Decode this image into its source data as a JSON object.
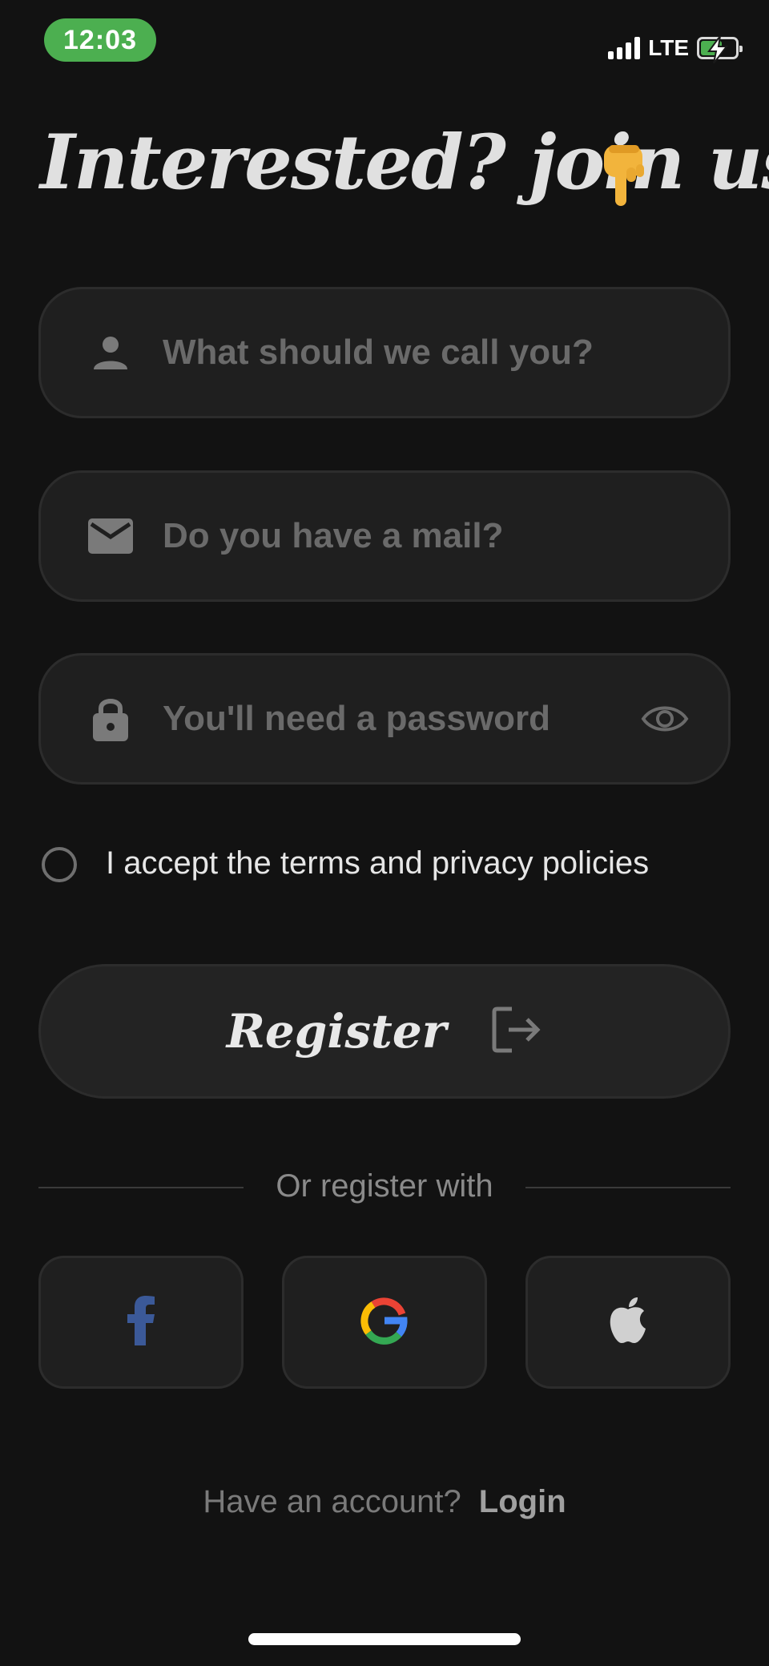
{
  "status_bar": {
    "time": "12:03",
    "network": "LTE"
  },
  "heading": {
    "title": "Interested? join us"
  },
  "form": {
    "name": {
      "placeholder": "What should we call you?",
      "value": ""
    },
    "email": {
      "placeholder": "Do you have a mail?",
      "value": ""
    },
    "password": {
      "placeholder": "You'll need a password",
      "value": ""
    }
  },
  "terms": {
    "label": "I accept the terms and privacy policies",
    "checked": false
  },
  "register_button": {
    "label": "Register"
  },
  "divider": {
    "label": "Or register with"
  },
  "social": [
    {
      "name": "facebook-icon",
      "color": "#3b5998"
    },
    {
      "name": "google-icon"
    },
    {
      "name": "apple-icon",
      "color": "#d0d0d0"
    }
  ],
  "footer": {
    "question": "Have an account?",
    "login_label": "Login"
  },
  "colors": {
    "background": "#121212",
    "field": "#1f1f1f",
    "time_pill": "#4caf50"
  }
}
